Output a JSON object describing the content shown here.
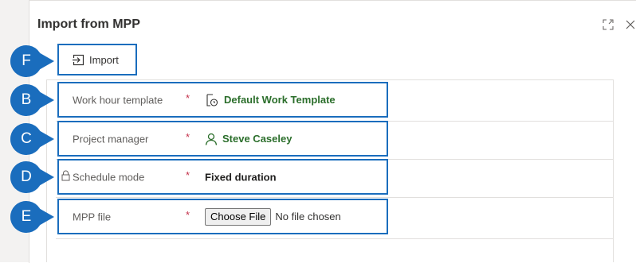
{
  "dialog": {
    "title": "Import from MPP"
  },
  "toolbar": {
    "import_label": "Import"
  },
  "fields": [
    {
      "marker": "B",
      "label": "Work hour template",
      "required": "*",
      "value": "Default Work Template"
    },
    {
      "marker": "C",
      "label": "Project manager",
      "required": "*",
      "value": "Steve Caseley"
    },
    {
      "marker": "D",
      "label": "Schedule mode",
      "required": "*",
      "value": "Fixed duration"
    },
    {
      "marker": "E",
      "label": "MPP file",
      "required": "*",
      "file_button": "Choose File",
      "file_status": "No file chosen"
    }
  ],
  "markers": {
    "toolbar": "F"
  },
  "colors": {
    "callout_fill": "#1a6dbd",
    "highlight_border": "#1a6dbd",
    "link_text": "#2b6e2b",
    "required_star": "#c4314b"
  },
  "icons": {
    "import": "import-icon",
    "template": "calendar-clock-icon",
    "person": "person-icon",
    "lock": "lock-icon",
    "expand": "expand-icon",
    "close": "close-icon"
  }
}
